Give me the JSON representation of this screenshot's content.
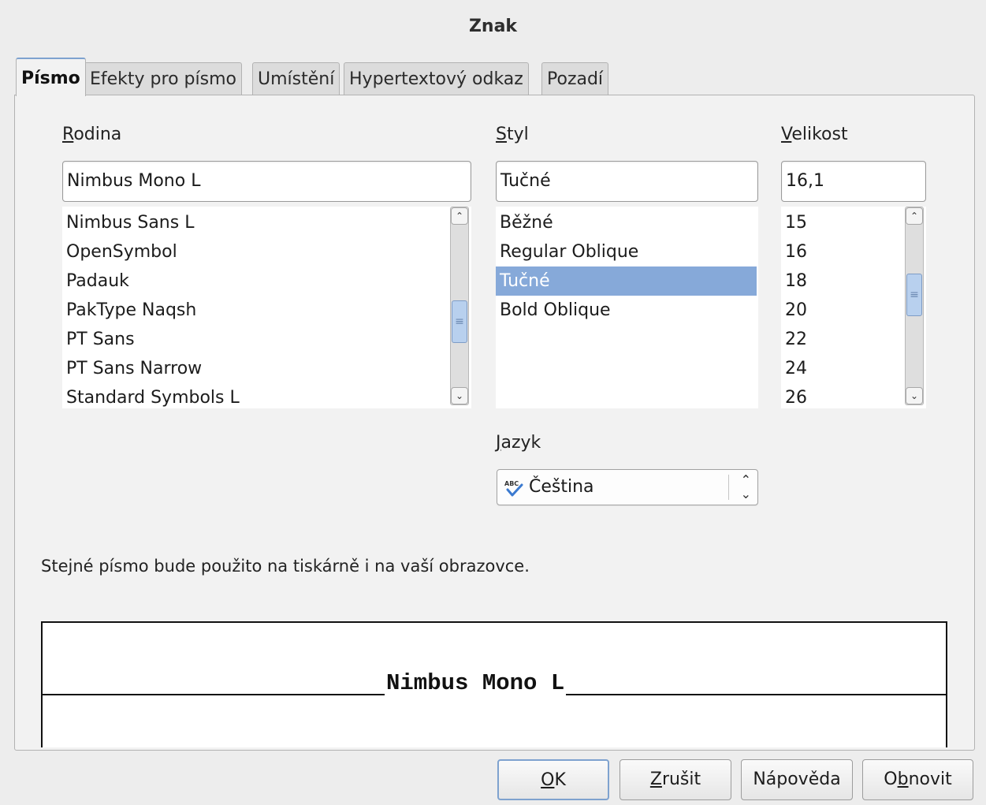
{
  "window": {
    "title": "Znak"
  },
  "tabs": [
    {
      "label": "Písmo",
      "active": true
    },
    {
      "label": "Efekty pro písmo",
      "active": false
    },
    {
      "label": "Umístění",
      "active": false
    },
    {
      "label": "Hypertextový odkaz",
      "active": false
    },
    {
      "label": "Pozadí",
      "active": false
    }
  ],
  "family": {
    "label_first": "R",
    "label_rest": "odina",
    "value": "Nimbus Mono L",
    "items": [
      "Nimbus Sans L",
      "OpenSymbol",
      "Padauk",
      "PakType Naqsh",
      "PT Sans",
      "PT Sans Narrow",
      "Standard Symbols L"
    ]
  },
  "style": {
    "label_first": "S",
    "label_rest": "tyl",
    "value": "Tučné",
    "items": [
      "Běžné",
      "Regular Oblique",
      "Tučné",
      "Bold Oblique"
    ],
    "selected": "Tučné"
  },
  "size": {
    "label_first": "V",
    "label_rest": "elikost",
    "value": "16,1",
    "items": [
      "15",
      "16",
      "18",
      "20",
      "22",
      "24",
      "26"
    ]
  },
  "language": {
    "label_first": "J",
    "label_rest": "azyk",
    "value": "Čeština",
    "icon": "spellcheck-icon"
  },
  "note": "Stejné písmo bude použito na tiskárně i na vaší obrazovce.",
  "preview": {
    "text": "Nimbus Mono L"
  },
  "buttons": {
    "ok": {
      "before": "",
      "mnemonic": "O",
      "after": "K"
    },
    "cancel": {
      "before": "",
      "mnemonic": "Z",
      "after": "rušit"
    },
    "help": {
      "before": "Nápověda",
      "mnemonic": "",
      "after": ""
    },
    "reset": {
      "before": "O",
      "mnemonic": "b",
      "after": "novit"
    }
  },
  "colors": {
    "selection": "#86a9d9",
    "focus": "#7ea2cf"
  }
}
